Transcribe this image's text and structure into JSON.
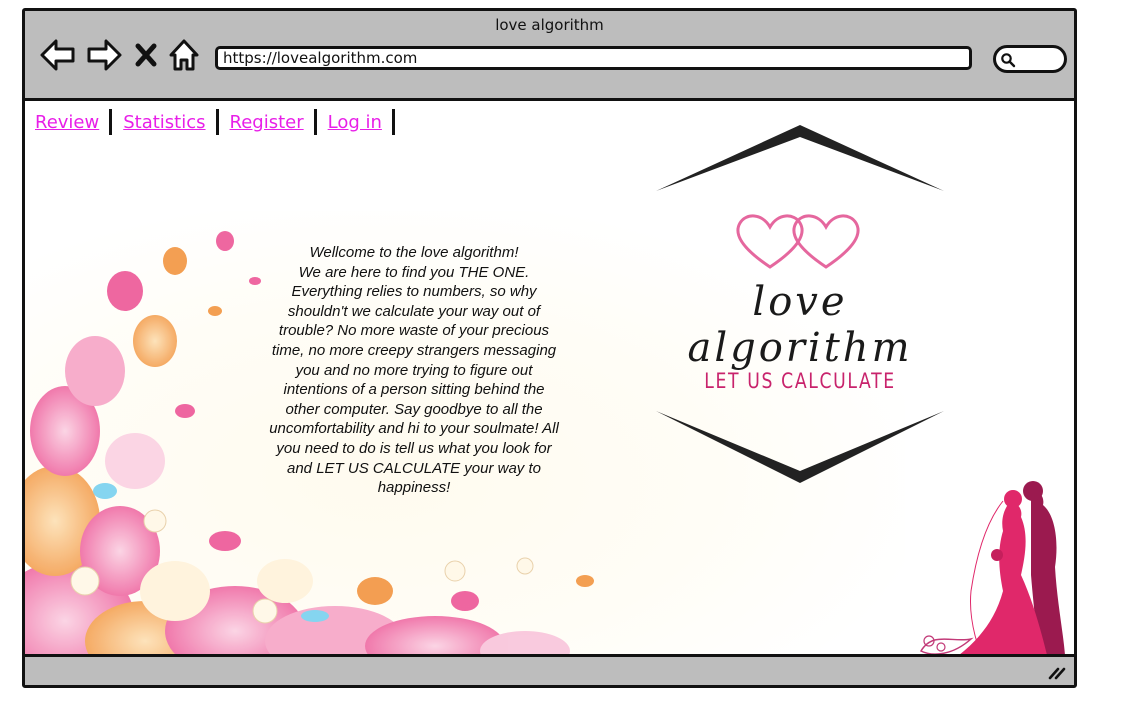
{
  "window": {
    "title": "love algorithm"
  },
  "toolbar": {
    "back_icon": "arrow-left-icon",
    "forward_icon": "arrow-right-icon",
    "stop_icon": "close-icon",
    "home_icon": "home-icon",
    "search_icon": "search-icon"
  },
  "address_bar": {
    "url": "https://lovealgorithm.com"
  },
  "nav": {
    "items": [
      {
        "label": "Review"
      },
      {
        "label": "Statistics"
      },
      {
        "label": "Register"
      },
      {
        "label": "Log in"
      }
    ]
  },
  "hero": {
    "welcome_lines": [
      "Wellcome to the love algorithm!",
      "We are here to find you THE ONE.",
      "Everything relies to numbers, so why",
      "shouldn't we calculate your way out of",
      "trouble? No more waste of your precious",
      "time, no more creepy strangers messaging",
      "you and no more trying to figure out",
      "intentions of a person sitting behind the",
      "other computer. Say goodbye to all the",
      "uncomfortability and hi to your soulmate! All",
      "you need to do is tell us what you look for",
      "and LET US CALCULATE your way to",
      "happiness!"
    ]
  },
  "logo": {
    "script_text": "love algorithm",
    "tagline": "LET US CALCULATE",
    "heart_color": "#e5679e",
    "tagline_color": "#c8236c"
  },
  "colors": {
    "chrome": "#bdbdbd",
    "link": "#e81ee8",
    "couple_dress": "#e0286a",
    "couple_suit": "#9b1a4f"
  }
}
